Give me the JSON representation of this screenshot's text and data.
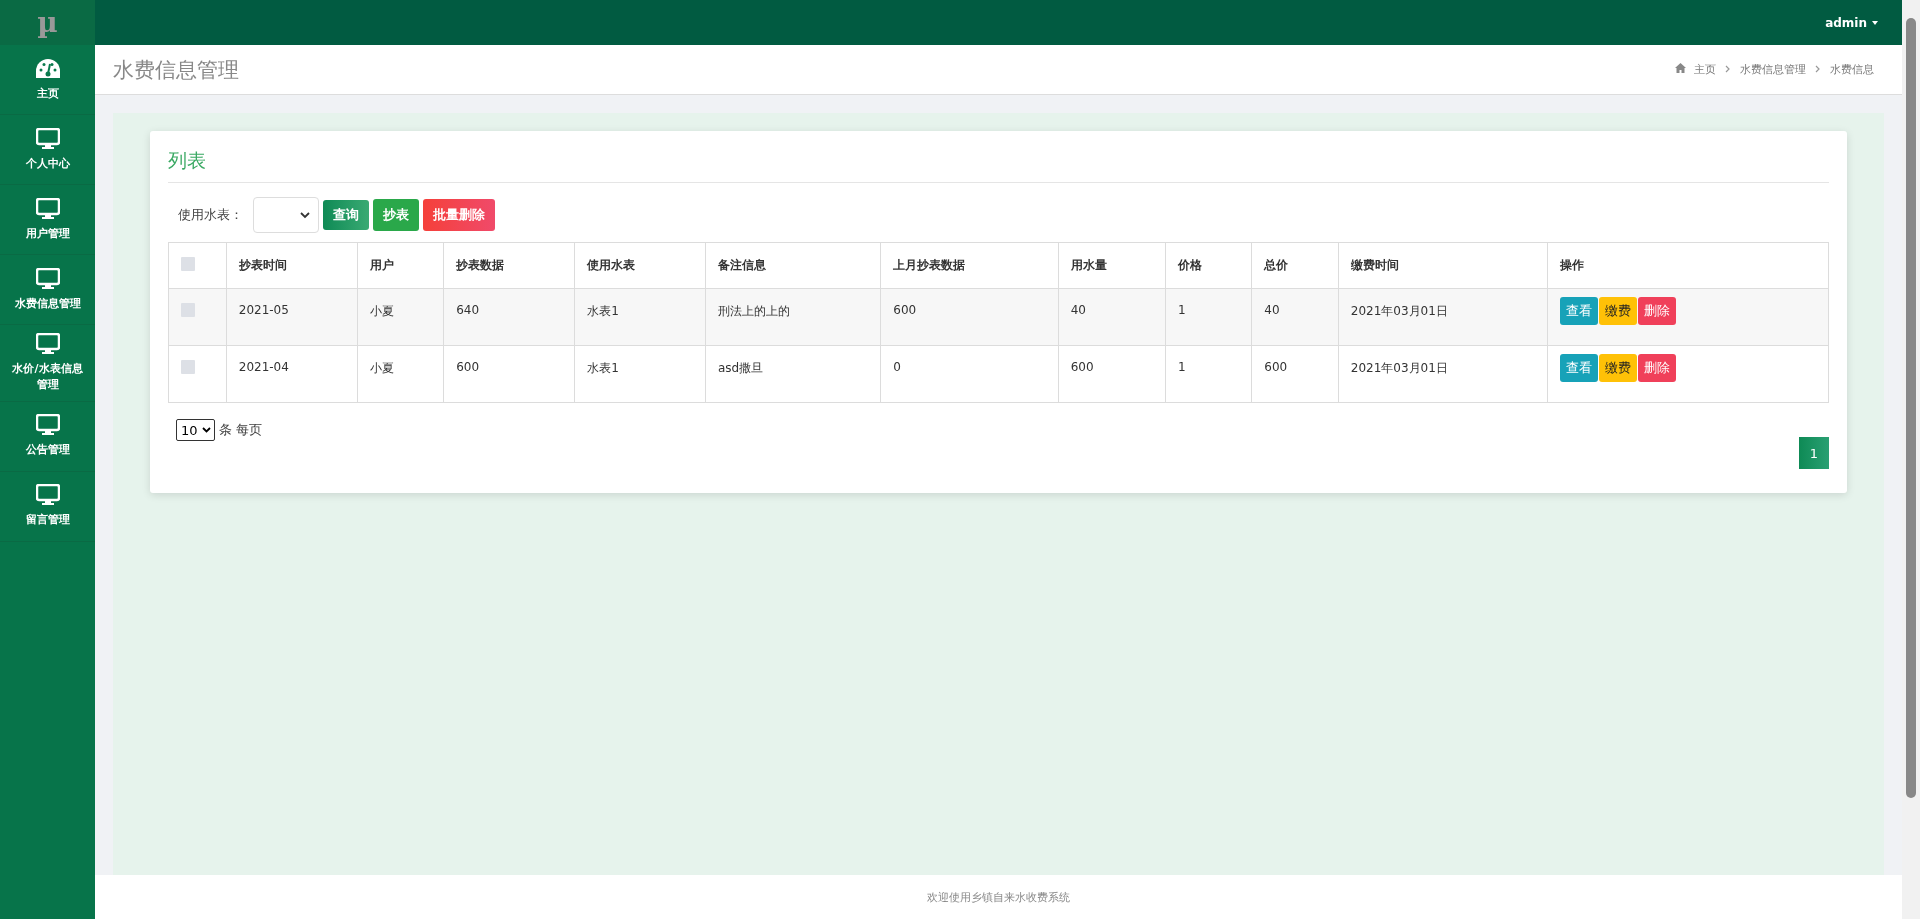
{
  "logo": "µ",
  "user_menu": {
    "label": "admin"
  },
  "sidebar": {
    "items": [
      {
        "label": "主页",
        "kind": "dashboard"
      },
      {
        "label": "个人中心",
        "kind": "monitor"
      },
      {
        "label": "用户管理",
        "kind": "monitor"
      },
      {
        "label": "水费信息管理",
        "kind": "monitor"
      },
      {
        "label": "水价/水表信息管理",
        "kind": "monitor"
      },
      {
        "label": "公告管理",
        "kind": "monitor"
      },
      {
        "label": "留言管理",
        "kind": "monitor"
      }
    ]
  },
  "page_title": "水费信息管理",
  "breadcrumb": [
    "主页",
    "水费信息管理",
    "水费信息"
  ],
  "card": {
    "title": "列表",
    "filter": {
      "label": "使用水表："
    },
    "buttons": [
      {
        "label": "查询",
        "kind": "search"
      },
      {
        "label": "抄表",
        "kind": "add"
      },
      {
        "label": "批量删除",
        "kind": "danger"
      }
    ],
    "table": {
      "select_all_checked": false,
      "columns": [
        "抄表时间",
        "用户",
        "抄表数据",
        "使用水表",
        "备注信息",
        "上月抄表数据",
        "用水量",
        "价格",
        "总价",
        "缴费时间",
        "操作"
      ],
      "rows": [
        {
          "checked": false,
          "cells": [
            "2021-05",
            "小夏",
            "640",
            "水表1",
            "刑法上的上的",
            "600",
            "40",
            "1",
            "40",
            "2021年03月01日"
          ],
          "actions": [
            {
              "label": "查看",
              "kind": "view"
            },
            {
              "label": "缴费",
              "kind": "pay"
            },
            {
              "label": "删除",
              "kind": "delete"
            }
          ]
        },
        {
          "checked": false,
          "cells": [
            "2021-04",
            "小夏",
            "600",
            "水表1",
            "asd撒旦",
            "0",
            "600",
            "1",
            "600",
            "2021年03月01日"
          ],
          "actions": [
            {
              "label": "查看",
              "kind": "view"
            },
            {
              "label": "缴费",
              "kind": "pay"
            },
            {
              "label": "删除",
              "kind": "delete"
            }
          ]
        }
      ]
    },
    "page_size": {
      "value": "10",
      "label": "条 每页"
    },
    "pagination": [
      {
        "label": "1",
        "selected": true
      }
    ]
  },
  "footer": "欢迎使用乡镇自来水收费系统"
}
